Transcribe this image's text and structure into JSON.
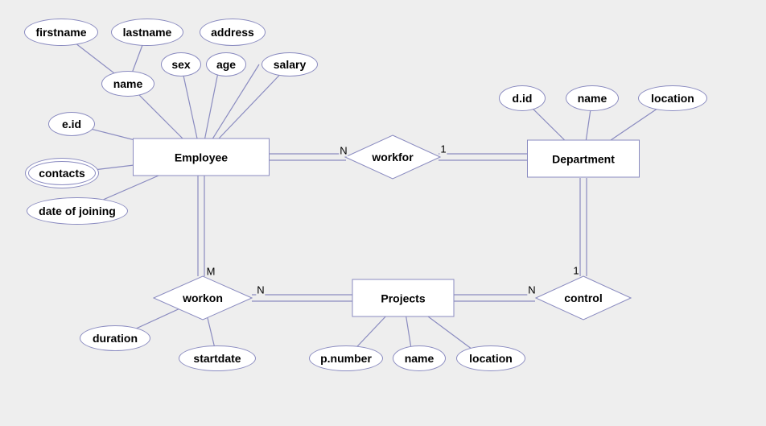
{
  "diagram": {
    "entities": {
      "employee": {
        "label": "Employee"
      },
      "department": {
        "label": "Department"
      },
      "projects": {
        "label": "Projects"
      }
    },
    "relationships": {
      "workfor": {
        "label": "workfor",
        "left_card": "N",
        "right_card": "1"
      },
      "workon": {
        "label": "workon",
        "top_card": "M",
        "right_card": "N"
      },
      "control": {
        "label": "control",
        "top_card": "1",
        "left_card": "N"
      }
    },
    "attributes": {
      "employee": {
        "firstname": {
          "label": "firstname"
        },
        "lastname": {
          "label": "lastname"
        },
        "address": {
          "label": "address"
        },
        "name": {
          "label": "name"
        },
        "sex": {
          "label": "sex"
        },
        "age": {
          "label": "age"
        },
        "salary": {
          "label": "salary"
        },
        "eid": {
          "label": "e.id"
        },
        "contacts": {
          "label": "contacts"
        },
        "dateofjoining": {
          "label": "date of joining"
        }
      },
      "department": {
        "did": {
          "label": "d.id"
        },
        "name": {
          "label": "name"
        },
        "location": {
          "label": "location"
        }
      },
      "projects": {
        "pnumber": {
          "label": "p.number"
        },
        "name": {
          "label": "name"
        },
        "location": {
          "label": "location"
        }
      },
      "workon": {
        "duration": {
          "label": "duration"
        },
        "startdate": {
          "label": "startdate"
        }
      }
    }
  },
  "chart_data": {
    "type": "er-diagram",
    "entities": [
      {
        "name": "Employee",
        "attributes": [
          "e.id",
          {
            "name": "name",
            "sub_attributes": [
              "firstname",
              "lastname"
            ]
          },
          "sex",
          "age",
          "address",
          "salary",
          {
            "name": "contacts",
            "multivalued": true
          },
          "date of joining"
        ]
      },
      {
        "name": "Department",
        "attributes": [
          "d.id",
          "name",
          "location"
        ]
      },
      {
        "name": "Projects",
        "attributes": [
          "p.number",
          "name",
          "location"
        ]
      }
    ],
    "relationships": [
      {
        "name": "workfor",
        "between": [
          "Employee",
          "Department"
        ],
        "cardinality": {
          "Employee": "N",
          "Department": "1"
        },
        "total_participation": [
          "Employee",
          "Department"
        ]
      },
      {
        "name": "workon",
        "between": [
          "Employee",
          "Projects"
        ],
        "cardinality": {
          "Employee": "M",
          "Projects": "N"
        },
        "total_participation": [
          "Employee",
          "Projects"
        ],
        "attributes": [
          "duration",
          "startdate"
        ]
      },
      {
        "name": "control",
        "between": [
          "Department",
          "Projects"
        ],
        "cardinality": {
          "Department": "1",
          "Projects": "N"
        },
        "total_participation": [
          "Department",
          "Projects"
        ]
      }
    ]
  }
}
